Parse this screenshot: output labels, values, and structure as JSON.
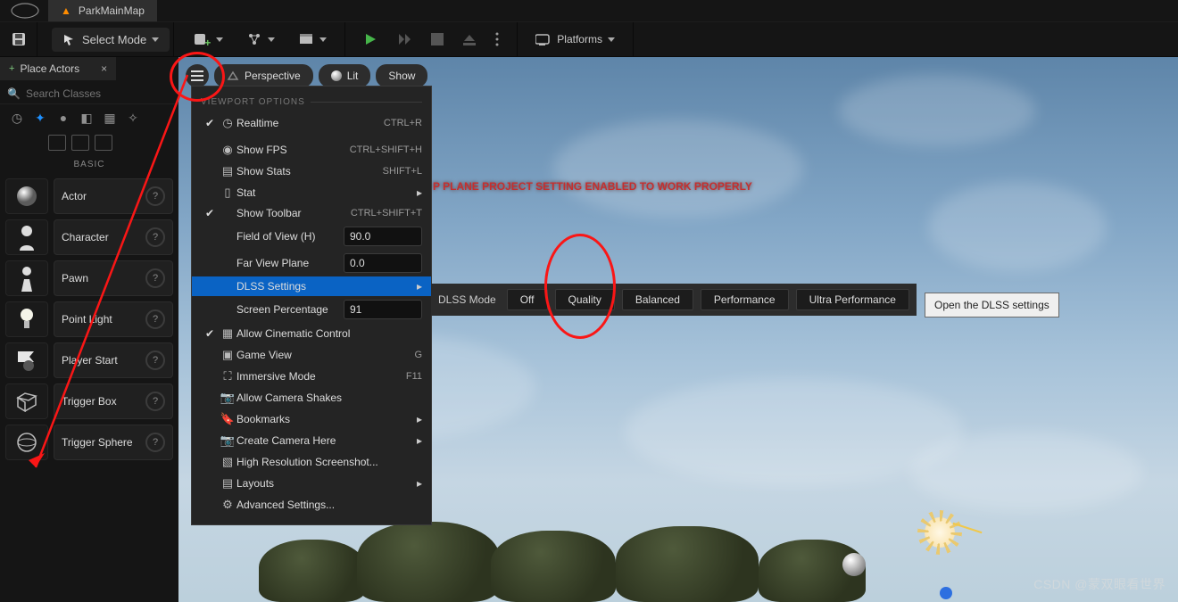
{
  "tab": {
    "title": "ParkMainMap",
    "icon": "flame-icon"
  },
  "toolbar": {
    "save": "save-icon",
    "select_mode": "Select Mode",
    "platforms": "Platforms"
  },
  "left_panel": {
    "tab_label": "Place Actors",
    "search_placeholder": "Search Classes",
    "section_label": "BASIC",
    "items": [
      {
        "label": "Actor"
      },
      {
        "label": "Character"
      },
      {
        "label": "Pawn"
      },
      {
        "label": "Point Light"
      },
      {
        "label": "Player Start"
      },
      {
        "label": "Trigger Box"
      },
      {
        "label": "Trigger Sphere"
      }
    ]
  },
  "viewport": {
    "buttons": {
      "perspective": "Perspective",
      "lit": "Lit",
      "show": "Show"
    },
    "warning": "P PLANE PROJECT SETTING ENABLED TO WORK PROPERLY"
  },
  "ctx": {
    "header": "VIEWPORT OPTIONS",
    "items": {
      "realtime": {
        "label": "Realtime",
        "shortcut": "CTRL+R"
      },
      "show_fps": {
        "label": "Show FPS",
        "shortcut": "CTRL+SHIFT+H"
      },
      "show_stats": {
        "label": "Show Stats",
        "shortcut": "SHIFT+L"
      },
      "stat": {
        "label": "Stat"
      },
      "show_toolbar": {
        "label": "Show Toolbar",
        "shortcut": "CTRL+SHIFT+T"
      },
      "fov": {
        "label": "Field of View (H)",
        "value": "90.0"
      },
      "far_plane": {
        "label": "Far View Plane",
        "value": "0.0"
      },
      "dlss": {
        "label": "DLSS Settings"
      },
      "screen_pct": {
        "label": "Screen Percentage",
        "value": "91"
      },
      "cinematic": {
        "label": "Allow Cinematic Control"
      },
      "game_view": {
        "label": "Game View",
        "shortcut": "G"
      },
      "immersive": {
        "label": "Immersive Mode",
        "shortcut": "F11"
      },
      "cam_shakes": {
        "label": "Allow Camera Shakes"
      },
      "bookmarks": {
        "label": "Bookmarks"
      },
      "create_camera": {
        "label": "Create Camera Here"
      },
      "hires": {
        "label": "High Resolution Screenshot..."
      },
      "layouts": {
        "label": "Layouts"
      },
      "advanced": {
        "label": "Advanced Settings..."
      }
    }
  },
  "dlss": {
    "mode_label": "DLSS Mode",
    "options": [
      "Off",
      "Quality",
      "Balanced",
      "Performance",
      "Ultra Performance"
    ],
    "tooltip": "Open the DLSS settings"
  },
  "watermark": "CSDN @蒙双眼看世界"
}
